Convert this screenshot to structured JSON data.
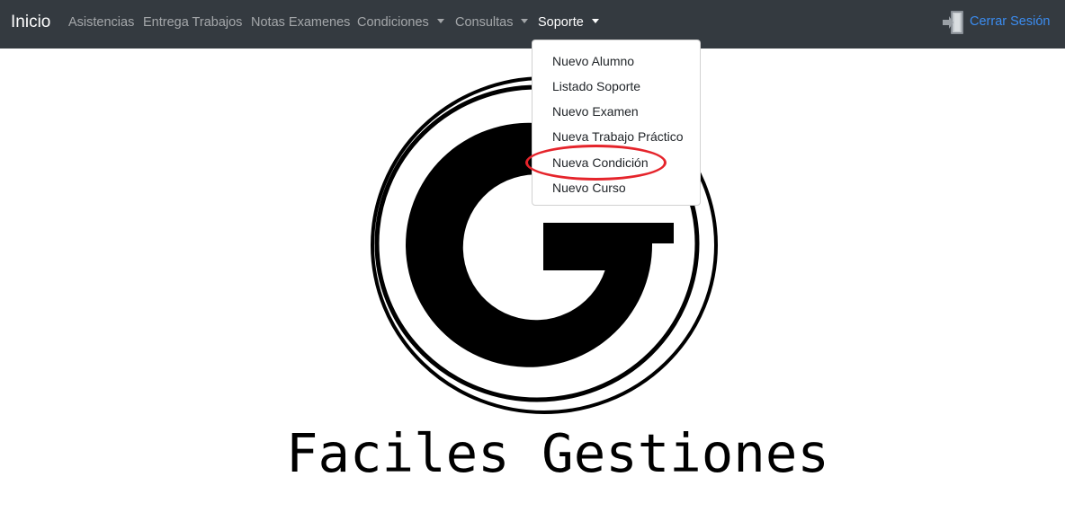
{
  "navbar": {
    "brand": "Inicio",
    "links": [
      {
        "label": "Asistencias"
      },
      {
        "label": "Entrega Trabajos"
      },
      {
        "label": "Notas Examenes"
      },
      {
        "label": "Condiciones"
      },
      {
        "label": "Consultas"
      },
      {
        "label": "Soporte"
      }
    ],
    "logout": {
      "label": "Cerrar Sesión",
      "icon": "logout-door-icon",
      "color": "#3b8cf0"
    },
    "background": "#343a40"
  },
  "dropdown": {
    "items": [
      {
        "label": "Nuevo Alumno"
      },
      {
        "label": "Listado Soporte"
      },
      {
        "label": "Nuevo Examen"
      },
      {
        "label": "Nueva Trabajo Práctico"
      },
      {
        "label": "Nueva Condición"
      },
      {
        "label": "Nuevo Curso"
      }
    ]
  },
  "annotation": {
    "color": "#e5242b"
  },
  "logo": {
    "text": "Faciles Gestiones",
    "icon": "g-logo-icon"
  }
}
